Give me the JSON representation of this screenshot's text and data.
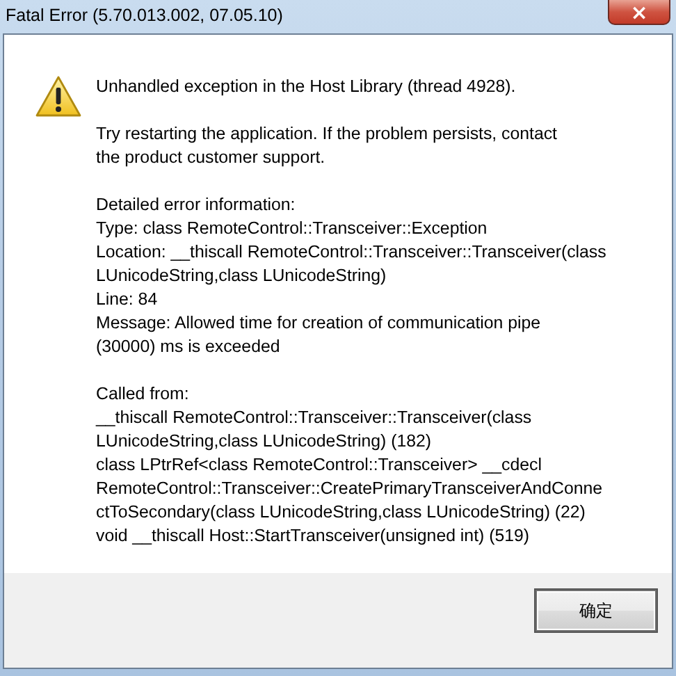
{
  "window": {
    "title": "Fatal Error (5.70.013.002, 07.05.10)",
    "close": "×"
  },
  "paragraphs": [
    {
      "lines": [
        "Unhandled exception in the Host Library (thread 4928)."
      ]
    },
    {
      "lines": [
        "Try restarting the application. If the problem persists, contact",
        "the product customer support."
      ]
    },
    {
      "lines": [
        "Detailed error information:",
        "Type: class RemoteControl::Transceiver::Exception",
        "Location: __thiscall RemoteControl::Transceiver::Transceiver(class",
        "LUnicodeString,class LUnicodeString)",
        "Line: 84",
        "Message: Allowed time for creation of communication pipe",
        "(30000) ms is exceeded"
      ]
    },
    {
      "lines": [
        "Called from:",
        "__thiscall RemoteControl::Transceiver::Transceiver(class",
        "LUnicodeString,class LUnicodeString) (182)",
        "class LPtrRef<class RemoteControl::Transceiver> __cdecl",
        "RemoteControl::Transceiver::CreatePrimaryTransceiverAndConne",
        "ctToSecondary(class LUnicodeString,class LUnicodeString) (22)",
        "void __thiscall Host::StartTransceiver(unsigned int) (519)"
      ]
    }
  ],
  "buttons": [
    {
      "label": "确定"
    }
  ]
}
